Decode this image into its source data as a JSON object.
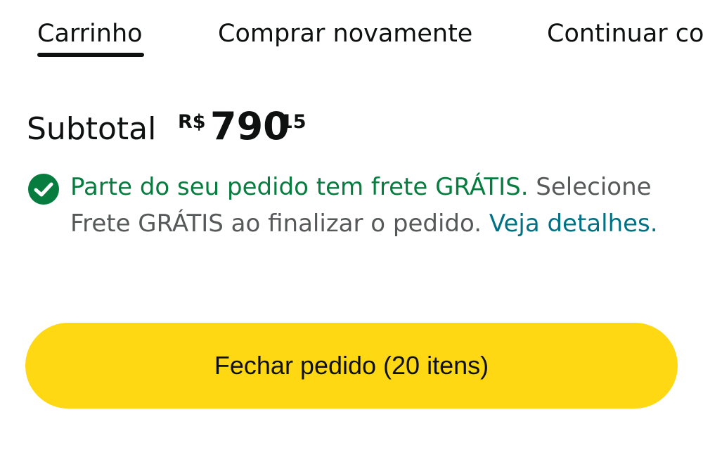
{
  "tabs": {
    "cart": "Carrinho",
    "buy_again": "Comprar novamente",
    "continue": "Continuar co"
  },
  "subtotal": {
    "label": "Subtotal",
    "currency": "R$",
    "whole": "790",
    "fraction": "15"
  },
  "shipping_notice": {
    "free_text": "Parte do seu pedido tem frete GRÁTIS.",
    "instruction": " Selecione Frete GRÁTIS ao finalizar o pedido. ",
    "details_link": "Veja detalhes."
  },
  "checkout": {
    "label": "Fechar pedido (20 itens)"
  },
  "colors": {
    "button": "#ffd814",
    "free": "#067d3f",
    "link": "#007185",
    "text": "#0f1111",
    "muted": "#565959"
  },
  "icons": {
    "check": "check-circle-icon"
  }
}
